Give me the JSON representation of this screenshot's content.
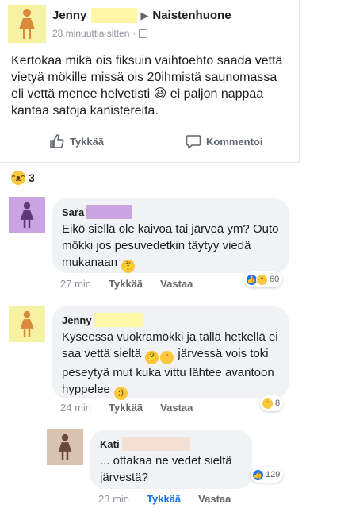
{
  "post": {
    "author": "Jenny",
    "group": "Naistenhuone",
    "time": "28 minuuttia sitten",
    "text": "Kertokaa mikä ois fiksuin vaihtoehto saada vettä vietyä mökille missä ois 20ihmistä saunomassa eli vettä menee helvetisti 😆 ei paljon nappaa kantaa satoja kanistereita.",
    "like_label": "Tykkää",
    "comment_label": "Kommentoi",
    "reaction_count": "3",
    "avatar_color": "#f6f2a3",
    "name_mask_color": "#fff6a6"
  },
  "comments": [
    {
      "author": "Sara",
      "text_1": "Eikö siellä ole kaivoa tai järveä ym? Outo mökki jos pesuvedetkin täytyy viedä mukanaan",
      "time": "27 min",
      "like": "Tykkää",
      "reply": "Vastaa",
      "reactions": "60",
      "avatar_color": "#c9a4e0",
      "name_mask_color": "#c9a4e0"
    },
    {
      "author": "Jenny",
      "text_1": "Kyseessä vuokramökki ja tällä hetkellä ei saa vettä sieltä",
      "text_2": "järvessä vois toki peseytyä mut kuka vittu lähtee avantoon hyppelee",
      "time": "24 min",
      "like": "Tykkää",
      "reply": "Vastaa",
      "reactions": "8",
      "avatar_color": "#f6f2a3",
      "name_mask_color": "#fff6a6"
    },
    {
      "author": "Kati",
      "text_1": "... ottakaa ne vedet sieltä järvestä?",
      "time": "23 min",
      "like": "Tykkää",
      "reply": "Vastaa",
      "reactions": "129",
      "avatar_color": "#d8c3b3",
      "name_mask_color": "#f3e1d4",
      "liked_color": "#1877f2"
    }
  ]
}
